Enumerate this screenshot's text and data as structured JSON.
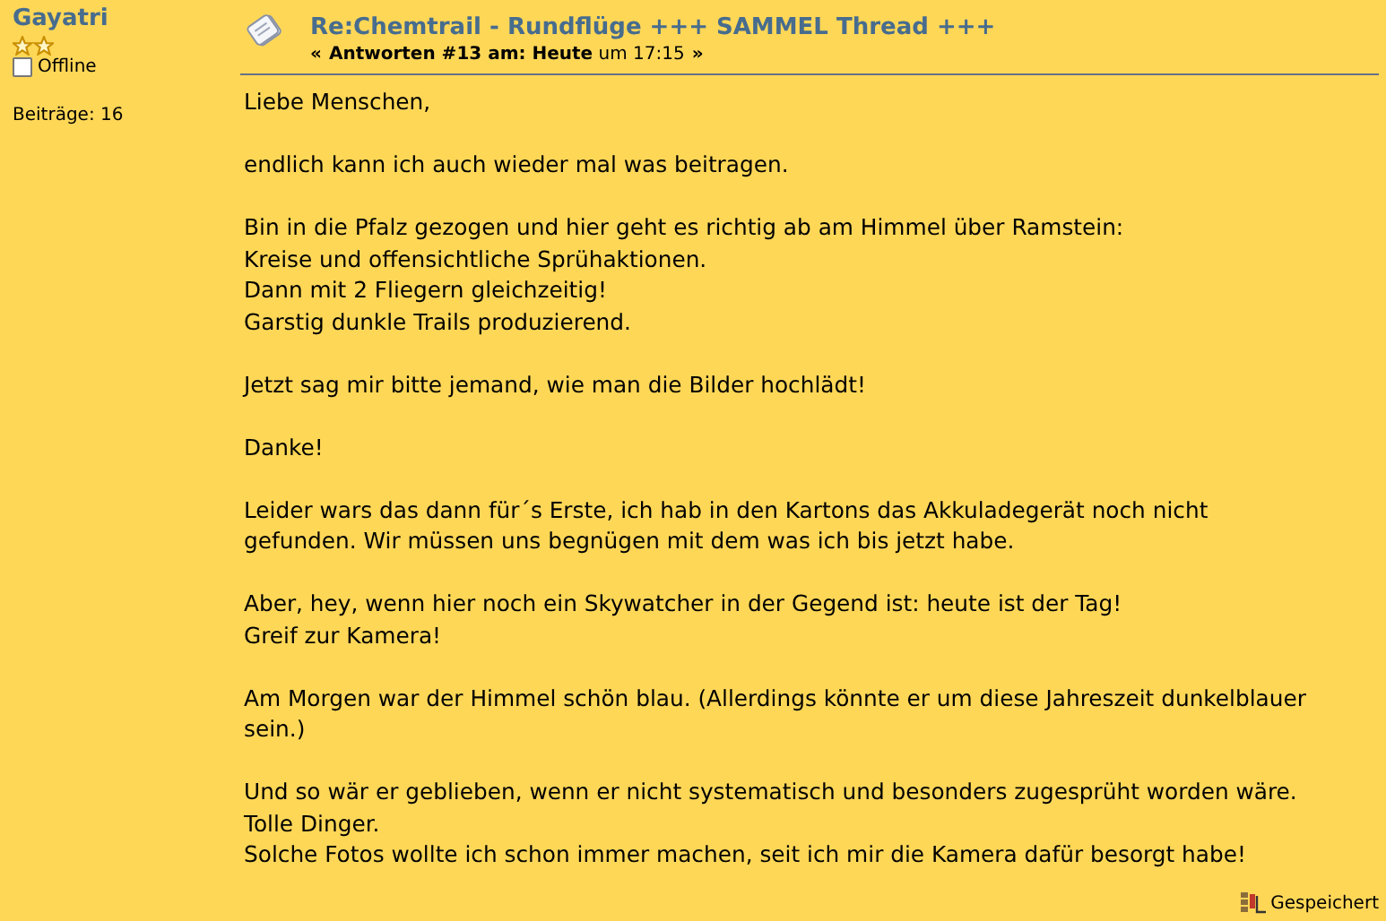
{
  "author": {
    "name": "Gayatri",
    "online": false,
    "status": "Offline",
    "posts": "Beiträge: 16"
  },
  "post": {
    "title": "Re:Chemtrail - Rundflüge +++ SAMMEL Thread +++",
    "prev": "«",
    "meta": "**Antworten #13 am: Heute** um 17:15",
    "next": "»",
    "paragraphs": [
      [
        "Liebe Menschen,"
      ],
      [
        "endlich kann ich auch wieder mal was beitragen."
      ],
      [
        "Bin in die Pfalz gezogen und hier geht es richtig ab am Himmel über Ramstein:",
        "Kreise und offensichtliche Sprühaktionen.",
        "Dann mit 2 Fliegern gleichzeitig!",
        "Garstig dunkle Trails produzierend."
      ],
      [
        "Jetzt sag mir bitte jemand, wie man die Bilder hochlädt!"
      ],
      [
        "Danke!"
      ],
      [
        "Leider wars das dann für´s Erste, ich hab in den Kartons das Akkuladegerät noch nicht",
        "gefunden. Wir müssen uns begnügen mit dem was ich bis jetzt habe."
      ],
      [
        "Aber, hey, wenn hier noch ein Skywatcher in der Gegend ist: heute ist der Tag!",
        "Greif zur Kamera!"
      ],
      [
        "Am Morgen war der Himmel schön blau. (Allerdings könnte er um diese Jahreszeit dunkelblauer",
        "sein.)"
      ],
      [
        "Und so wär er geblieben, wenn er nicht systematisch und besonders zugesprüht worden wäre.",
        "Tolle Dinger.",
        "Solche Fotos wollte ich schon immer machen, seit ich mir die Kamera dafür besorgt habe!"
      ]
    ],
    "saved": "Gespeichert"
  }
}
